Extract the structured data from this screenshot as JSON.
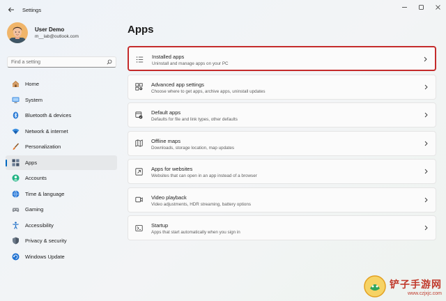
{
  "window": {
    "title": "Settings",
    "controls": [
      "minimize-icon",
      "maximize-icon",
      "close-icon"
    ]
  },
  "profile": {
    "name": "User Demo",
    "email": "m__lab@outlook.com"
  },
  "search": {
    "placeholder": "Find a setting",
    "icon": "search-icon"
  },
  "nav": {
    "items": [
      {
        "label": "Home",
        "icon": "home-icon"
      },
      {
        "label": "System",
        "icon": "system-icon"
      },
      {
        "label": "Bluetooth & devices",
        "icon": "bluetooth-icon"
      },
      {
        "label": "Network & internet",
        "icon": "network-icon"
      },
      {
        "label": "Personalization",
        "icon": "brush-icon"
      },
      {
        "label": "Apps",
        "icon": "apps-icon",
        "active": true
      },
      {
        "label": "Accounts",
        "icon": "accounts-icon"
      },
      {
        "label": "Time & language",
        "icon": "time-language-icon"
      },
      {
        "label": "Gaming",
        "icon": "gaming-icon"
      },
      {
        "label": "Accessibility",
        "icon": "accessibility-icon"
      },
      {
        "label": "Privacy & security",
        "icon": "shield-icon"
      },
      {
        "label": "Windows Update",
        "icon": "update-icon"
      }
    ]
  },
  "main": {
    "title": "Apps",
    "cards": [
      {
        "title": "Installed apps",
        "desc": "Uninstall and manage apps on your PC",
        "icon": "installed-apps-icon",
        "highlighted": true
      },
      {
        "title": "Advanced app settings",
        "desc": "Choose where to get apps, archive apps, uninstall updates",
        "icon": "advanced-apps-icon"
      },
      {
        "title": "Default apps",
        "desc": "Defaults for file and link types, other defaults",
        "icon": "default-apps-icon"
      },
      {
        "title": "Offline maps",
        "desc": "Downloads, storage location, map updates",
        "icon": "map-icon"
      },
      {
        "title": "Apps for websites",
        "desc": "Websites that can open in an app instead of a browser",
        "icon": "apps-websites-icon"
      },
      {
        "title": "Video playback",
        "desc": "Video adjustments, HDR streaming, battery options",
        "icon": "video-icon"
      },
      {
        "title": "Startup",
        "desc": "Apps that start automatically when you sign in",
        "icon": "startup-icon"
      }
    ]
  },
  "watermark": {
    "text": "铲子手游网",
    "url": "www.czjxjc.com"
  },
  "colors": {
    "accent": "#0067c0",
    "highlight_border": "#c42b2b"
  }
}
